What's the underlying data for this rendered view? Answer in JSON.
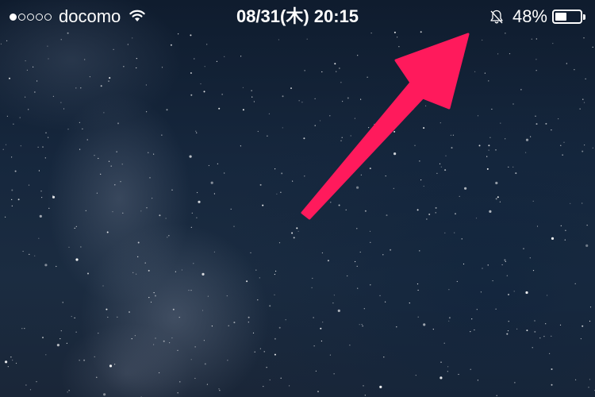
{
  "status_bar": {
    "signal_strength_filled": 1,
    "signal_strength_total": 5,
    "carrier": "docomo",
    "wifi_icon": "wifi-icon",
    "datetime": "08/31(木) 20:15",
    "silent_icon": "bell-slash-icon",
    "battery_percent": "48%",
    "battery_level": 0.48
  },
  "wallpaper": {
    "description_icon": "night-sky-milky-way"
  },
  "annotation": {
    "arrow_color": "#ff1a5c",
    "arrow_icon": "pointer-arrow-icon"
  }
}
